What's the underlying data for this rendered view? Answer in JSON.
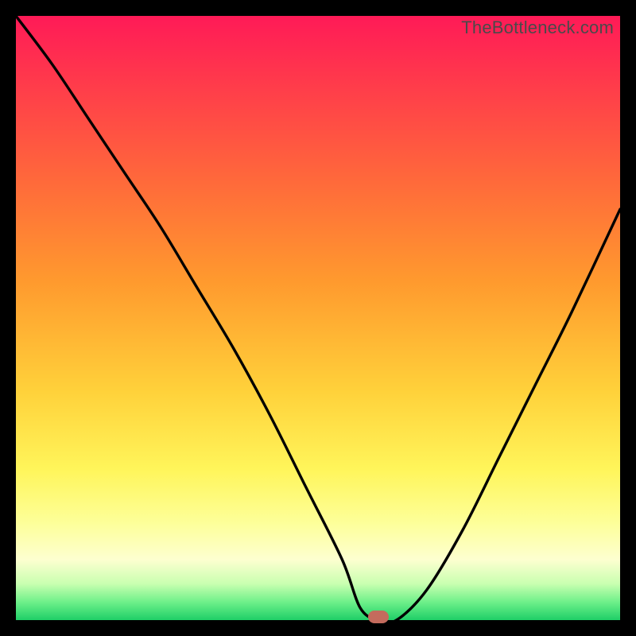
{
  "attribution": "TheBottleneck.com",
  "marker": {
    "x_pct": 60,
    "y_pct": 100
  },
  "chart_data": {
    "type": "line",
    "title": "",
    "xlabel": "",
    "ylabel": "",
    "xlim": [
      0,
      100
    ],
    "ylim": [
      0,
      100
    ],
    "annotations": [
      {
        "label": "marker",
        "x": 60,
        "y": 0,
        "color": "#c46b5d"
      }
    ],
    "series": [
      {
        "name": "bottleneck-curve",
        "x": [
          0,
          6,
          12,
          18,
          24,
          30,
          36,
          42,
          48,
          54,
          57,
          60,
          63,
          68,
          74,
          80,
          86,
          92,
          100
        ],
        "values": [
          100,
          92,
          83,
          74,
          65,
          55,
          45,
          34,
          22,
          10,
          2,
          0,
          0,
          5,
          15,
          27,
          39,
          51,
          68
        ]
      }
    ],
    "background_gradient": {
      "direction": "vertical",
      "stops": [
        {
          "pos": 0,
          "color": "#ff1a57"
        },
        {
          "pos": 12,
          "color": "#ff3d4a"
        },
        {
          "pos": 28,
          "color": "#ff6b3a"
        },
        {
          "pos": 44,
          "color": "#ff9a2e"
        },
        {
          "pos": 62,
          "color": "#ffd13a"
        },
        {
          "pos": 75,
          "color": "#fff55a"
        },
        {
          "pos": 84,
          "color": "#fdff9a"
        },
        {
          "pos": 90,
          "color": "#fdffd0"
        },
        {
          "pos": 94,
          "color": "#c9ffb0"
        },
        {
          "pos": 97,
          "color": "#6ef08a"
        },
        {
          "pos": 100,
          "color": "#1fcf67"
        }
      ]
    }
  }
}
